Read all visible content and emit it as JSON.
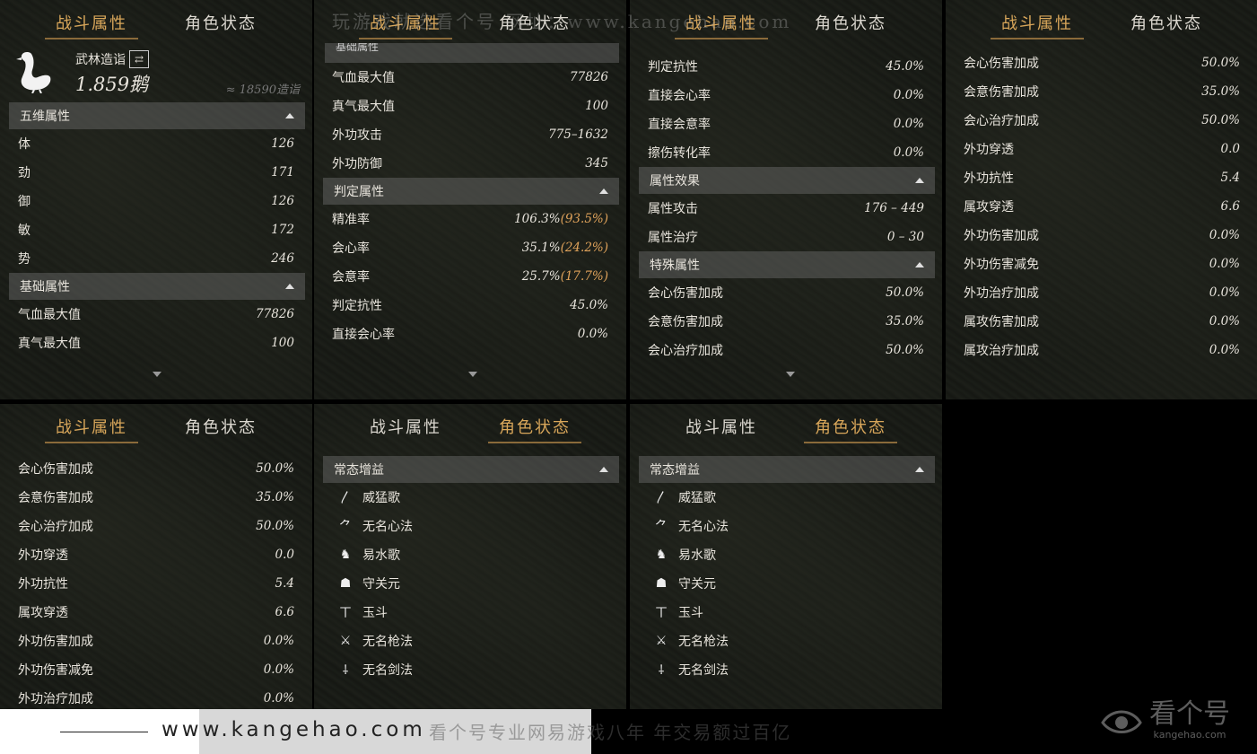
{
  "tabs": {
    "combat": "战斗属性",
    "status": "角色状态"
  },
  "watermark_top": "玩游戏就选看个号  网址：www.kangehao.com",
  "profile": {
    "name": "武林造诣",
    "value": "1.859鹅",
    "approx": "≈ 18590造诣"
  },
  "panel1": {
    "sec_wuwei": "五维属性",
    "wuwei": [
      {
        "label": "体",
        "value": "126"
      },
      {
        "label": "劲",
        "value": "171"
      },
      {
        "label": "御",
        "value": "126"
      },
      {
        "label": "敏",
        "value": "172"
      },
      {
        "label": "势",
        "value": "246"
      }
    ],
    "sec_base": "基础属性",
    "base": [
      {
        "label": "气血最大值",
        "value": "77826"
      },
      {
        "label": "真气最大值",
        "value": "100"
      }
    ]
  },
  "panel2": {
    "partial_header": "基础属性",
    "base": [
      {
        "label": "气血最大值",
        "value": "77826"
      },
      {
        "label": "真气最大值",
        "value": "100"
      },
      {
        "label": "外功攻击",
        "value": "775–1632"
      },
      {
        "label": "外功防御",
        "value": "345"
      }
    ],
    "sec_judge": "判定属性",
    "judge": [
      {
        "label": "精准率",
        "value": "106.3%",
        "extra": "(93.5%)"
      },
      {
        "label": "会心率",
        "value": "35.1%",
        "extra": "(24.2%)"
      },
      {
        "label": "会意率",
        "value": "25.7%",
        "extra": "(17.7%)"
      },
      {
        "label": "判定抗性",
        "value": "45.0%",
        "extra": ""
      },
      {
        "label": "直接会心率",
        "value": "0.0%",
        "extra": ""
      }
    ]
  },
  "panel3": {
    "rows_top": [
      {
        "label": "判定抗性",
        "value": "45.0%"
      },
      {
        "label": "直接会心率",
        "value": "0.0%"
      },
      {
        "label": "直接会意率",
        "value": "0.0%"
      },
      {
        "label": "擦伤转化率",
        "value": "0.0%"
      }
    ],
    "sec_effect": "属性效果",
    "effect": [
      {
        "label": "属性攻击",
        "value": "176 – 449"
      },
      {
        "label": "属性治疗",
        "value": "0 – 30"
      }
    ],
    "sec_special": "特殊属性",
    "special": [
      {
        "label": "会心伤害加成",
        "value": "50.0%"
      },
      {
        "label": "会意伤害加成",
        "value": "35.0%"
      },
      {
        "label": "会心治疗加成",
        "value": "50.0%"
      }
    ]
  },
  "panel4": {
    "rows": [
      {
        "label": "会心伤害加成",
        "value": "50.0%"
      },
      {
        "label": "会意伤害加成",
        "value": "35.0%"
      },
      {
        "label": "会心治疗加成",
        "value": "50.0%"
      },
      {
        "label": "外功穿透",
        "value": "0.0"
      },
      {
        "label": "外功抗性",
        "value": "5.4"
      },
      {
        "label": "属攻穿透",
        "value": "6.6"
      },
      {
        "label": "外功伤害加成",
        "value": "0.0%"
      },
      {
        "label": "外功伤害减免",
        "value": "0.0%"
      },
      {
        "label": "外功治疗加成",
        "value": "0.0%"
      },
      {
        "label": "属攻伤害加成",
        "value": "0.0%"
      },
      {
        "label": "属攻治疗加成",
        "value": "0.0%"
      }
    ]
  },
  "panel5": {
    "rows": [
      {
        "label": "会心伤害加成",
        "value": "50.0%"
      },
      {
        "label": "会意伤害加成",
        "value": "35.0%"
      },
      {
        "label": "会心治疗加成",
        "value": "50.0%"
      },
      {
        "label": "外功穿透",
        "value": "0.0"
      },
      {
        "label": "外功抗性",
        "value": "5.4"
      },
      {
        "label": "属攻穿透",
        "value": "6.6"
      },
      {
        "label": "外功伤害加成",
        "value": "0.0%"
      },
      {
        "label": "外功伤害减免",
        "value": "0.0%"
      },
      {
        "label": "外功治疗加成",
        "value": "0.0%"
      }
    ]
  },
  "buffs": {
    "section": "常态增益",
    "items": [
      {
        "name": "威猛歌",
        "icon": "feather-icon",
        "glyph": "〳"
      },
      {
        "name": "无名心法",
        "icon": "brush-icon",
        "glyph": "⺈"
      },
      {
        "name": "易水歌",
        "icon": "horse-icon",
        "glyph": "♞"
      },
      {
        "name": "守关元",
        "icon": "dome-icon",
        "glyph": "☗"
      },
      {
        "name": "玉斗",
        "icon": "cross-icon",
        "glyph": "ㄒ"
      },
      {
        "name": "无名枪法",
        "icon": "spear-icon",
        "glyph": "⚔"
      },
      {
        "name": "无名剑法",
        "icon": "sword-icon",
        "glyph": "⸸"
      }
    ]
  },
  "footer": {
    "url": "www.kangehao.com",
    "slogan": "看个号专业网易游戏八年  年交易额过百亿",
    "brand_cn": "看个号",
    "brand_en": "kangehao.com"
  }
}
